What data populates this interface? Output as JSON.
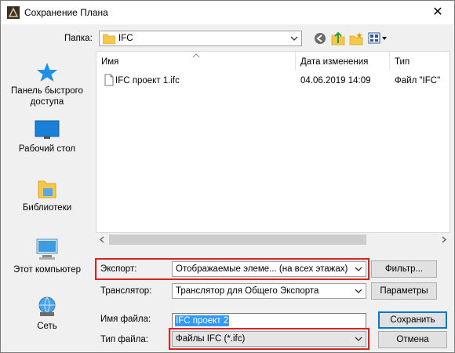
{
  "window": {
    "title": "Сохранение Плана",
    "close_glyph": "✕"
  },
  "folder": {
    "label": "Папка:",
    "value": "IFC"
  },
  "places": [
    {
      "label": "Панель быстрого доступа",
      "icon": "star-icon"
    },
    {
      "label": "Рабочий стол",
      "icon": "desktop-icon"
    },
    {
      "label": "Библиотеки",
      "icon": "libraries-icon"
    },
    {
      "label": "Этот компьютер",
      "icon": "computer-icon"
    },
    {
      "label": "Сеть",
      "icon": "network-icon"
    }
  ],
  "columns": {
    "name": "Имя",
    "date": "Дата изменения",
    "type": "Тип"
  },
  "files": [
    {
      "name": "IFC проект 1.ifc",
      "date": "04.06.2019 14:09",
      "type": "Файл \"IFC\""
    }
  ],
  "export": {
    "label": "Экспорт:",
    "value": "Отображаемые элеме... (на всех этажах)",
    "button": "Фильтр..."
  },
  "translator": {
    "label": "Транслятор:",
    "value": "Транслятор для Общего Экспорта",
    "button": "Параметры"
  },
  "filename": {
    "label": "Имя файла:",
    "value": "IFC проект 2"
  },
  "filetype": {
    "label": "Тип файла:",
    "value": "Файлы IFC (*.ifc)"
  },
  "buttons": {
    "save": "Сохранить",
    "cancel": "Отмена"
  },
  "colors": {
    "highlight_box": "#e02020",
    "selection": "#3399ff"
  }
}
